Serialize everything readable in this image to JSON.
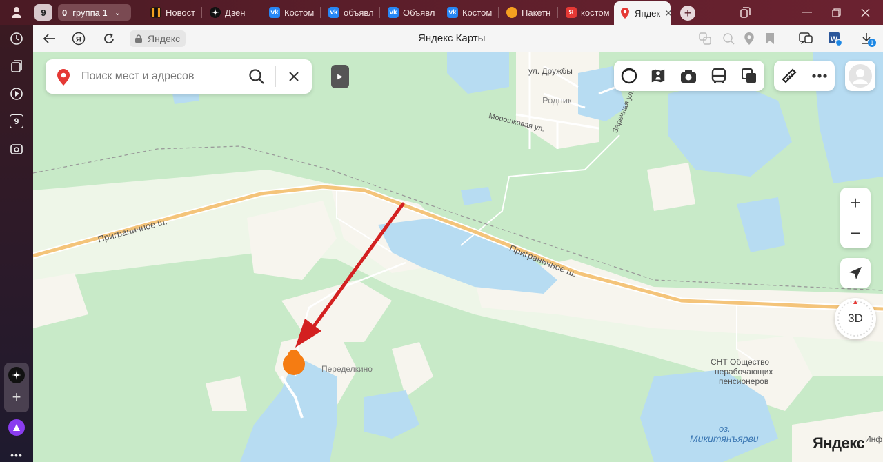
{
  "tabbar": {
    "counter_badge": "9",
    "group_count": "0",
    "group_label": "группа 1",
    "tabs": [
      {
        "label": "Новост",
        "icon": "news-icon",
        "color": "#e8a020"
      },
      {
        "label": "Дзен",
        "icon": "dzen-icon",
        "color": "#111111"
      },
      {
        "label": "Костом",
        "icon": "vk-icon",
        "color": "#2787f5"
      },
      {
        "label": "объявл",
        "icon": "vk-icon",
        "color": "#2787f5"
      },
      {
        "label": "Объявл",
        "icon": "vk-icon",
        "color": "#2787f5"
      },
      {
        "label": "Костом",
        "icon": "vk-icon",
        "color": "#2787f5"
      },
      {
        "label": "Пакетн",
        "icon": "circle-icon",
        "color": "#f6a020"
      },
      {
        "label": "костом",
        "icon": "yandex-icon",
        "color": "#e53935"
      },
      {
        "label": "Яндек",
        "icon": "maps-pin-icon",
        "color": "#e53935",
        "active": true
      }
    ]
  },
  "sidebar": {
    "counter": "9"
  },
  "addressbar": {
    "url_text": "Яндекс",
    "page_title": "Яндекс Карты",
    "download_badge": "1"
  },
  "search": {
    "placeholder": "Поиск мест и адресов"
  },
  "map": {
    "labels": {
      "street1": "ул. Дружбы",
      "place1": "Родник",
      "street2": "Морошковая ул.",
      "street3": "Заречная ул.",
      "road1": "Приграничное ш.",
      "road2": "Приграничное ш.",
      "village": "Переделкино",
      "snt1": "СНТ Общество",
      "snt2": "нерабочающих",
      "snt3": "пенсионеров",
      "lake1": "оз.",
      "lake2": "Микитянъярви",
      "edge": "Инф"
    },
    "btn_3d": "3D",
    "zoom_in": "+",
    "zoom_out": "−",
    "logo": "Яндекс"
  },
  "colors": {
    "forest": "#c8eac8",
    "field": "#f7f5ee",
    "water": "#b7dcf2",
    "road": "#f4c47a",
    "arrow": "#d32020",
    "marker": "#f57c12"
  }
}
